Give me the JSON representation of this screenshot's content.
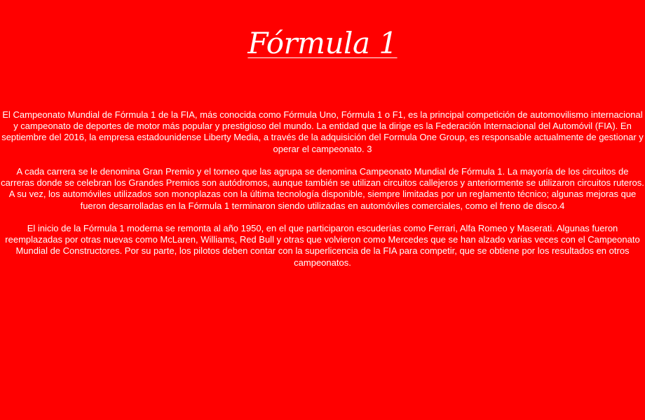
{
  "page": {
    "title": "Fórmula 1"
  },
  "article": {
    "paragraphs": [
      "El Campeonato Mundial de Fórmula 1 de la FIA, más conocida como Fórmula Uno, Fórmula 1 o F1, es la principal competición de automovilismo internacional y campeonato de deportes de motor más popular y prestigioso del mundo. La entidad que la dirige es la Federación Internacional del Automóvil (FIA). En septiembre del 2016, la empresa estadounidense Liberty Media, a través de la adquisición del Formula One Group, es responsable actualmente de gestionar y operar el campeonato. 3",
      "A cada carrera se le denomina Gran Premio y el torneo que las agrupa se denomina Campeonato Mundial de Fórmula 1. La mayoría de los circuitos de carreras donde se celebran los Grandes Premios son autódromos, aunque también se utilizan circuitos callejeros y anteriormente se utilizaron circuitos ruteros. A su vez, los automóviles utilizados son monoplazas con la última tecnología disponible, siempre limitadas por un reglamento técnico; algunas mejoras que fueron desarrolladas en la Fórmula 1 terminaron siendo utilizadas en automóviles comerciales, como el freno de disco.4",
      "El inicio de la Fórmula 1 moderna se remonta al año 1950, en el que participaron escuderías como Ferrari, Alfa Romeo y Maserati. Algunas fueron reemplazadas por otras nuevas como McLaren, Williams, Red Bull y otras que volvieron como Mercedes que se han alzado varias veces con el Campeonato Mundial de Constructores. Por su parte, los pilotos deben contar con la superlicencia de la FIA para competir, que se obtiene por los resultados en otros campeonatos."
    ]
  },
  "colors": {
    "background": "#ff0000",
    "text": "#ffffff"
  }
}
